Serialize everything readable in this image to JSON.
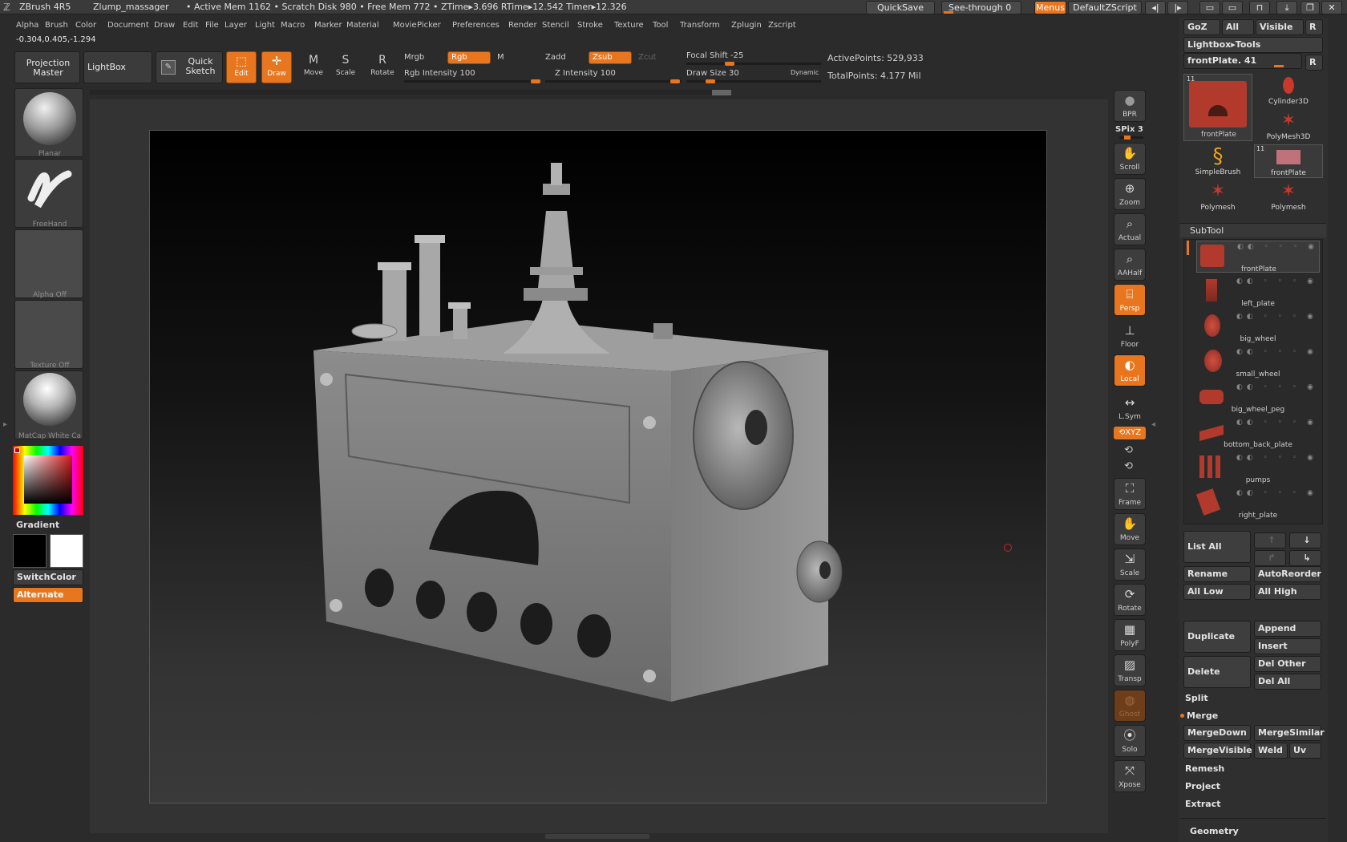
{
  "titlebar": {
    "app": "ZBrush 4R5",
    "doc": "Zlump_massager",
    "stats": "• Active Mem 1162  • Scratch Disk 980  • Free Mem 772  • ZTime▸3.696 RTime▸12.542 Timer▸12.326",
    "quicksave": "QuickSave",
    "seethrough": "See-through   0",
    "menus": "Menus",
    "defaultzscript": "DefaultZScript"
  },
  "menus": [
    "Alpha",
    "Brush",
    "Color",
    "Document",
    "Draw",
    "Edit",
    "File",
    "Layer",
    "Light",
    "Macro",
    "Marker",
    "Material",
    "Movie",
    "Picker",
    "Preferences",
    "Render",
    "Stencil",
    "Stroke",
    "Texture",
    "Tool",
    "Transform",
    "Zplugin",
    "Zscript"
  ],
  "coords": "-0.304,0.405,-1.294",
  "toolbar": {
    "projection_master": "Projection Master",
    "lightbox": "LightBox",
    "quick_sketch": "Quick Sketch",
    "edit": "Edit",
    "draw": "Draw",
    "move": "Move",
    "scale": "Scale",
    "rotate": "Rotate",
    "mrgb": "Mrgb",
    "rgb": "Rgb",
    "m": "M",
    "rgb_intensity": "Rgb Intensity 100",
    "zadd": "Zadd",
    "zsub": "Zsub",
    "zcut": "Zcut",
    "z_intensity": "Z Intensity 100",
    "focal_shift": "Focal Shift -25",
    "draw_size": "Draw Size 30",
    "dynamic": "Dynamic",
    "active_points": "ActivePoints: 529,933",
    "total_points": "TotalPoints: 4.177 Mil"
  },
  "leftpanel": {
    "brush1": "Planar",
    "brush2": "FreeHand",
    "alpha": "Alpha  Off",
    "texture": "Texture  Off",
    "material": "MatCap  White  Ca",
    "gradient": "Gradient",
    "switchcolor": "SwitchColor",
    "alternate": "Alternate"
  },
  "dock": {
    "bpr": "BPR",
    "spix": "SPix 3",
    "scroll": "Scroll",
    "zoom": "Zoom",
    "actual": "Actual",
    "aahalf": "AAHalf",
    "persp": "Persp",
    "floor": "Floor",
    "local": "Local",
    "lsym": "L.Sym",
    "xyz": "XYZ",
    "frame": "Frame",
    "move": "Move",
    "scale": "Scale",
    "rotate": "Rotate",
    "polyf": "PolyF",
    "transp": "Transp",
    "ghost": "Ghost",
    "solo": "Solo",
    "xpose": "Xpose"
  },
  "rightpanel": {
    "goz": "GoZ",
    "all": "All",
    "visible": "Visible",
    "r": "R",
    "lightbox_tools": "Lightbox▸Tools",
    "current_tool": "frontPlate. 41",
    "tools": [
      {
        "name": "frontPlate",
        "icon": "frontplate-thumb-icon"
      },
      {
        "name": "Cylinder3D",
        "icon": "cylinder-icon"
      },
      {
        "name": "PolyMesh3D",
        "icon": "star-icon"
      },
      {
        "name": "SimpleBrush",
        "icon": "simplebrush-icon"
      },
      {
        "name": "frontPlate",
        "icon": "frontplate-thumb-icon"
      },
      {
        "name": "Polymesh",
        "icon": "star-icon"
      },
      {
        "name": "Polymesh",
        "icon": "star-icon"
      }
    ],
    "tool_badge": "11",
    "subtool_title": "SubTool",
    "subtools": [
      "frontPlate",
      "left_plate",
      "big_wheel",
      "small_wheel",
      "big_wheel_peg",
      "bottom_back_plate",
      "pumps",
      "right_plate"
    ],
    "list_all": "List  All",
    "rename": "Rename",
    "autoreorder": "AutoReorder",
    "all_low": "All  Low",
    "all_high": "All  High",
    "duplicate": "Duplicate",
    "append": "Append",
    "insert": "Insert",
    "delete": "Delete",
    "del_other": "Del  Other",
    "del_all": "Del  All",
    "split": "Split",
    "merge": "Merge",
    "mergedown": "MergeDown",
    "mergesimilar": "MergeSimilar",
    "mergevisible": "MergeVisible",
    "weld": "Weld",
    "uv": "Uv",
    "remesh": "Remesh",
    "project": "Project",
    "extract": "Extract",
    "geometry": "Geometry"
  },
  "colors": {
    "accent": "#e8761e",
    "panel": "#2f2f2f",
    "tool_red": "#c8392b"
  }
}
